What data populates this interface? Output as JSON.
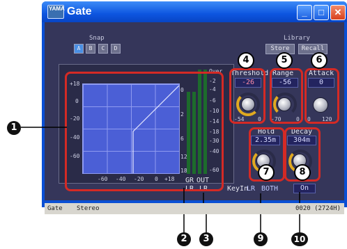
{
  "window": {
    "title": "Gate",
    "app_icon": "yamaha-app-icon"
  },
  "snap": {
    "label": "Snap",
    "buttons": [
      "A",
      "B",
      "C",
      "D"
    ],
    "active": "A"
  },
  "library": {
    "label": "Library",
    "store": "Store",
    "recall": "Recall"
  },
  "graph": {
    "y_ticks": [
      "+18",
      "0",
      "-20",
      "-40",
      "-60"
    ],
    "x_ticks": [
      "-60",
      "-40",
      "-20",
      "0",
      "+18"
    ]
  },
  "meters": {
    "left_scale": [
      "0",
      "2",
      "6",
      "12",
      "18"
    ],
    "right_scale": [
      "Over",
      "-2",
      "-4",
      "-6",
      "-10",
      "-14",
      "-18",
      "-30",
      "-40",
      "-60"
    ],
    "labels": {
      "gr": "GR",
      "out": "OUT",
      "lr_gr": "LR",
      "lr_out": "LR"
    }
  },
  "params": {
    "threshold": {
      "label": "Threshold",
      "value": "-26",
      "min": "-54",
      "max": "0"
    },
    "range": {
      "label": "Range",
      "value": "-56",
      "min": "-70",
      "max": "0"
    },
    "attack": {
      "label": "Attack",
      "value": "0",
      "min": "0",
      "max": "120"
    },
    "hold": {
      "label": "Hold",
      "value": "2.35m"
    },
    "decay": {
      "label": "Decay",
      "value": "304m"
    }
  },
  "keyin": {
    "label": "KeyIn",
    "lr": "LR",
    "both": "BOTH",
    "on": "On"
  },
  "status_bar": {
    "left": "Gate",
    "middle": "Stereo",
    "right": "0020 (2724H)"
  },
  "callouts": {
    "n1": "1",
    "n2": "2",
    "n3": "3",
    "n4": "4",
    "n5": "5",
    "n6": "6",
    "n7": "7",
    "n8": "8",
    "n9": "9",
    "n10": "10"
  },
  "colors": {
    "title_blue": "#0d55e0",
    "panel": "#35365a",
    "graph": "#4b5fd6",
    "callout_red": "#d42a25",
    "knob_ring": "#e0a920"
  }
}
